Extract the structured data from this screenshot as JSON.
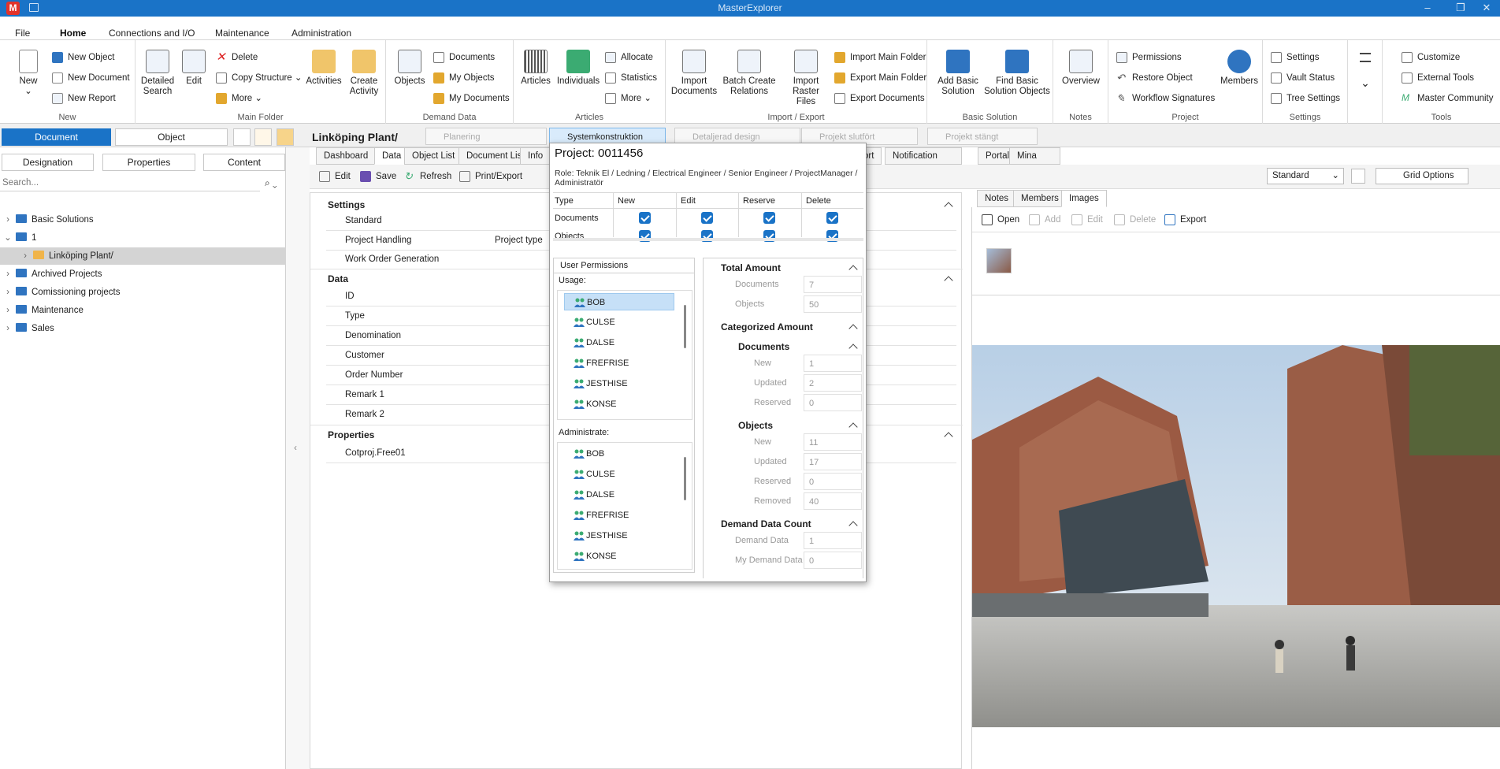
{
  "app": {
    "title": "MasterExplorer",
    "icon": "M"
  },
  "menu": {
    "items": [
      "File",
      "Home",
      "Connections and I/O",
      "Maintenance",
      "Administration"
    ],
    "active": "Home"
  },
  "ribbon": {
    "new": {
      "label": "New",
      "new_object": "New Object",
      "new_document": "New Document",
      "new_report": "New Report",
      "group": "New"
    },
    "main_folder": {
      "detailed_search": "Detailed Search",
      "edit": "Edit",
      "delete": "Delete",
      "copy_structure": "Copy Structure",
      "more": "More",
      "activities": "Activities",
      "create_activity": "Create Activity",
      "group": "Main Folder"
    },
    "demand": {
      "objects": "Objects",
      "documents": "Documents",
      "my_objects": "My Objects",
      "my_documents": "My Documents",
      "group": "Demand Data"
    },
    "articles": {
      "articles": "Articles",
      "individuals": "Individuals",
      "allocate": "Allocate",
      "statistics": "Statistics",
      "more": "More",
      "group": "Articles"
    },
    "import_export": {
      "import_documents": "Import Documents",
      "batch_create": "Batch Create Relations",
      "import_raster": "Import Raster Files",
      "import_main_folder": "Import Main Folder",
      "export_main_folder": "Export Main Folder",
      "export_documents": "Export Documents",
      "group": "Import / Export"
    },
    "basic": {
      "add_basic": "Add Basic Solution",
      "find_basic": "Find Basic Solution Objects",
      "group": "Basic Solution"
    },
    "notes": {
      "overview": "Overview",
      "group": "Notes"
    },
    "project": {
      "permissions": "Permissions",
      "restore_object": "Restore Object",
      "workflow_signatures": "Workflow Signatures",
      "members": "Members",
      "group": "Project"
    },
    "settings": {
      "settings": "Settings",
      "vault_status": "Vault Status",
      "tree_settings": "Tree Settings",
      "group": "Settings"
    },
    "tools": {
      "customize": "Customize",
      "external_tools": "External Tools",
      "master_community": "Master Community",
      "group": "Tools"
    }
  },
  "left": {
    "doc_btn": "Document",
    "obj_btn": "Object",
    "tabs": [
      "Designation",
      "Properties",
      "Content"
    ],
    "search_placeholder": "Search...",
    "tree": [
      "Basic Solutions",
      "1",
      "Linköping Plant/",
      "Archived Projects",
      "Comissioning projects",
      "Maintenance",
      "Sales"
    ]
  },
  "breadcrumb": {
    "root": "Linköping Plant/",
    "steps": [
      "Planering",
      "Systemkonstruktion",
      "Detaljerad design",
      "Projekt slutfört",
      "Projekt stängt"
    ],
    "current": "Systemkonstruktion"
  },
  "center": {
    "tabs": [
      "Dashboard",
      "Data",
      "Object List",
      "Document List",
      "Info",
      "ort",
      "Notification Center",
      "Portal",
      "Mina uppgifter"
    ],
    "toolbar": {
      "edit": "Edit",
      "save": "Save",
      "refresh": "Refresh",
      "print": "Print/Export"
    },
    "settings_header": "Settings",
    "settings_rows": [
      "Standard",
      "Project Handling",
      "Work Order Generation"
    ],
    "project_type": "Project type",
    "data_header": "Data",
    "data_rows": [
      "ID",
      "Type",
      "Denomination",
      "Customer",
      "Order Number",
      "Remark 1",
      "Remark 2"
    ],
    "props_header": "Properties",
    "props_rows": [
      "Cotproj.Free01"
    ],
    "view_select": "Standard",
    "grid_options": "Grid Options"
  },
  "popup": {
    "title": "Project: 0011456",
    "role": "Role: Teknik El / Ledning / Electrical Engineer / Senior Engineer / ProjectManager / Administratör",
    "perm_headers": [
      "Type",
      "New",
      "Edit",
      "Reserve",
      "Delete"
    ],
    "perm_rows": [
      "Documents",
      "Objects"
    ],
    "user_perm_tab": "User Permissions",
    "usage_label": "Usage:",
    "usage": [
      "BOB",
      "CULSE",
      "DALSE",
      "FREFRISE",
      "JESTHISE",
      "KONSE"
    ],
    "admin_label": "Administrate:",
    "admin": [
      "BOB",
      "CULSE",
      "DALSE",
      "FREFRISE",
      "JESTHISE",
      "KONSE"
    ],
    "total_amount": "Total Amount",
    "total": [
      {
        "label": "Documents",
        "value": "7"
      },
      {
        "label": "Objects",
        "value": "50"
      }
    ],
    "categorized": "Categorized Amount",
    "documents_header": "Documents",
    "documents": [
      {
        "label": "New",
        "value": "1"
      },
      {
        "label": "Updated",
        "value": "2"
      },
      {
        "label": "Reserved",
        "value": "0"
      }
    ],
    "objects_header": "Objects",
    "objects": [
      {
        "label": "New",
        "value": "11"
      },
      {
        "label": "Updated",
        "value": "17"
      },
      {
        "label": "Reserved",
        "value": "0"
      },
      {
        "label": "Removed",
        "value": "40"
      }
    ],
    "demand_header": "Demand Data Count",
    "demand": [
      {
        "label": "Demand Data",
        "value": "1"
      },
      {
        "label": "My Demand Data",
        "value": "0"
      }
    ]
  },
  "right": {
    "tabs": [
      "Notes",
      "Members",
      "Images"
    ],
    "active_tab": "Images",
    "toolbar": {
      "open": "Open",
      "add": "Add",
      "edit": "Edit",
      "delete": "Delete",
      "export": "Export"
    }
  }
}
